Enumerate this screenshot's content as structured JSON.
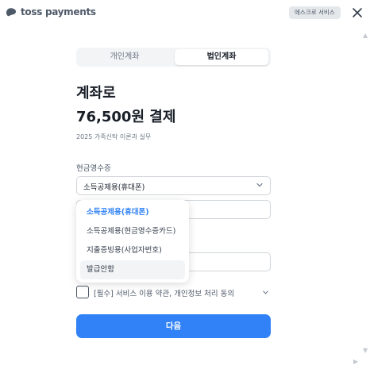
{
  "header": {
    "brand": "toss payments",
    "escrow_button": "에스크로 서비스",
    "close_icon": "close-icon"
  },
  "tabs": [
    {
      "label": "개인계좌",
      "active": false
    },
    {
      "label": "법인계좌",
      "active": true
    }
  ],
  "payment": {
    "title_line1": "계좌로",
    "title_line2": "76,500원 결제",
    "subtitle": "2025 가족신탁 이론과 실무"
  },
  "receipt": {
    "label": "현금영수증",
    "selected": "소득공제용(휴대폰)",
    "options": [
      "소득공제용(휴대폰)",
      "소득공제용(현금영수증카드)",
      "지출증빙용(사업자번호)",
      "발급안함"
    ]
  },
  "consent": {
    "text": "[필수] 서비스 이용 약관, 개인정보 처리 동의"
  },
  "next_button": "다음",
  "colors": {
    "accent": "#3182f6",
    "text": "#191f28",
    "muted": "#6b7684"
  }
}
